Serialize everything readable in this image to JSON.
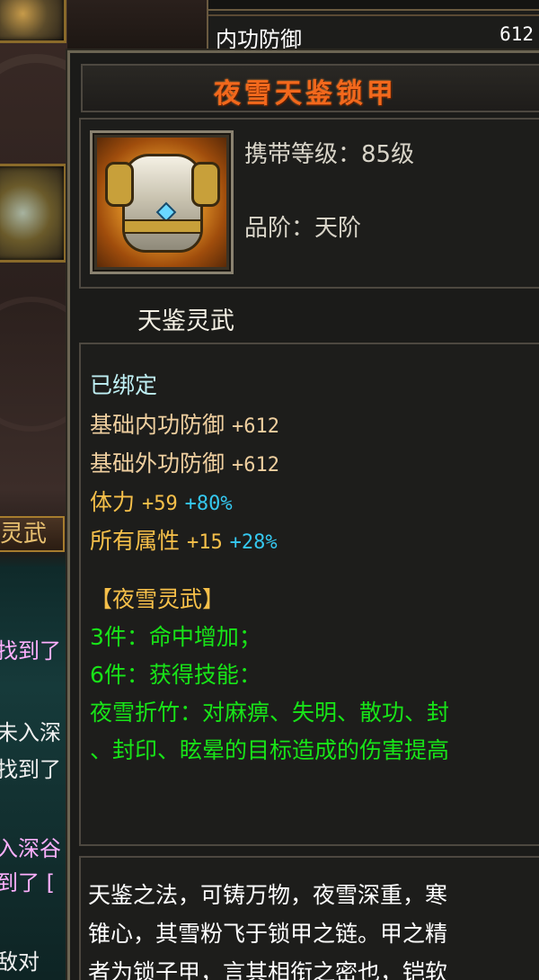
{
  "background": {
    "top_stat": {
      "name": "内功防御",
      "value": "612"
    },
    "side_tab_label": "灵武",
    "chat_lines": [
      {
        "text": "找到了",
        "color": "pink"
      },
      {
        "text": "未入深",
        "color": "white"
      },
      {
        "text": "找到了",
        "color": "white"
      },
      {
        "text": "入深谷",
        "color": "pink"
      },
      {
        "text": "到了 [",
        "color": "pink"
      },
      {
        "text": "敌对",
        "color": "white"
      }
    ]
  },
  "tooltip": {
    "title": "夜雪天鉴锁甲",
    "icon": "armor-chestplate-icon",
    "level_label": "携带等级：85级",
    "grade_label": "品阶：天阶",
    "spirit_label": "天鉴灵武",
    "bound": "已绑定",
    "base_stats": [
      {
        "name": "基础内功防御",
        "value": "+612"
      },
      {
        "name": "基础外功防御",
        "value": "+612"
      }
    ],
    "bonus_stats": [
      {
        "name": "体力",
        "value": "+59",
        "percent": "+80%"
      },
      {
        "name": "所有属性",
        "value": "+15",
        "percent": "+28%"
      }
    ],
    "set": {
      "name": "【夜雪灵武】",
      "tier3": "3件：命中增加；",
      "tier6": "6件：获得技能：",
      "skill_line1": "夜雪折竹：对麻痹、失明、散功、封",
      "skill_line2": "、封印、眩晕的目标造成的伤害提高"
    },
    "description": {
      "line1": "天鉴之法，可铸万物，夜雪深重，寒",
      "line2": "锥心，其雪粉飞于锁甲之链。甲之精",
      "line3": "者为锁子甲，言其相衔之密也，铠软"
    }
  },
  "colors": {
    "title": "#f2681c",
    "bound": "#bff0f4",
    "base": "#f0d0a0",
    "bonus": "#f6c04a",
    "percent": "#35c8f0",
    "set": "#18e418"
  }
}
